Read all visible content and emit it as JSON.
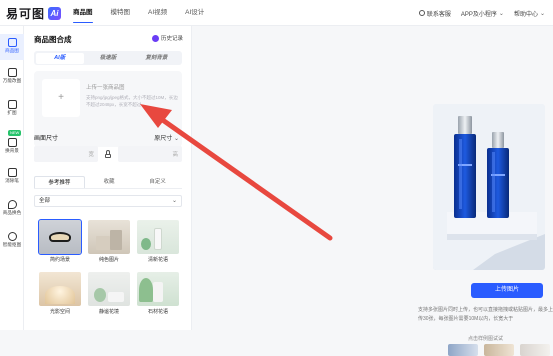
{
  "brand": {
    "logo_text": "易可图",
    "ai_badge": "Ai"
  },
  "nav": {
    "items": [
      "商品图",
      "模特图",
      "AI视频",
      "AI设计"
    ],
    "active": 0
  },
  "top_right": {
    "service": "联系客服",
    "app": "APP及小程序",
    "help": "帮助中心"
  },
  "left_nav": {
    "items": [
      {
        "label": "商品图",
        "icon": "product-image-icon"
      },
      {
        "label": "万能改图",
        "icon": "edit-image-icon"
      },
      {
        "label": "扩图",
        "icon": "expand-image-icon"
      },
      {
        "label": "换背景",
        "icon": "swap-background-icon"
      },
      {
        "label": "消除笔",
        "icon": "eraser-icon"
      },
      {
        "label": "商品换色",
        "icon": "recolor-icon"
      },
      {
        "label": "智能抠图",
        "icon": "cutout-icon"
      }
    ],
    "new_badge": "NEW"
  },
  "panel": {
    "title": "商品图合成",
    "history": "历史记录",
    "modes": [
      "AI版",
      "极速版",
      "复刻背景"
    ],
    "upload": {
      "title": "上传一张商品图",
      "tip": "支持png/jpg/jpeg格式，大小不超过10M，长边不超过2048px，长宽不超过"
    },
    "size_label": "画面尺寸",
    "size_option": "原尺寸",
    "tabs": [
      "参考推荐",
      "收藏",
      "自定义"
    ],
    "filter": "全部",
    "cards": [
      "简约场景",
      "纯色图片",
      "清新花语",
      "光影空间",
      "静谧花境",
      "石材花语"
    ]
  },
  "main": {
    "upload_button": "上传图片",
    "desc": "支持多张图片同时上传，也可以直接拖拽或粘贴图片，最多上传30张，每张图片需要10M以内，长宽大于",
    "examples_title": "点击样例图试试"
  },
  "colors": {
    "accent": "#2a5cff",
    "arrow": "#e8483f",
    "new": "#27c36b"
  }
}
